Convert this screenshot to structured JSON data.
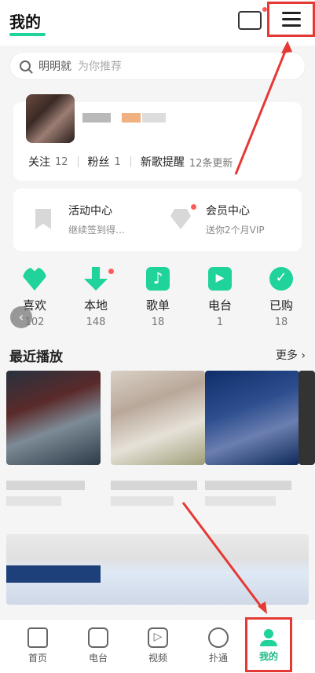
{
  "header": {
    "title": "我的"
  },
  "search": {
    "value": "明明就",
    "hint": "为你推荐"
  },
  "profile": {
    "follow_label": "关注",
    "follow_count": "12",
    "fans_label": "粉丝",
    "fans_count": "1",
    "newsong_label": "新歌提醒",
    "newsong_info": "12条更新"
  },
  "activity": {
    "left": {
      "title": "活动中心",
      "sub": "继续签到得…"
    },
    "right": {
      "title": "会员中心",
      "sub": "送你2个月VIP"
    }
  },
  "quick": [
    {
      "label": "喜欢",
      "count": "102"
    },
    {
      "label": "本地",
      "count": "148"
    },
    {
      "label": "歌单",
      "count": "18"
    },
    {
      "label": "电台",
      "count": "1"
    },
    {
      "label": "已购",
      "count": "18"
    }
  ],
  "recent": {
    "title": "最近播放",
    "more": "更多"
  },
  "tabs": [
    {
      "label": "首页"
    },
    {
      "label": "电台"
    },
    {
      "label": "视频"
    },
    {
      "label": "扑通"
    },
    {
      "label": "我的"
    }
  ],
  "colors": {
    "accent": "#1fd39a",
    "highlight": "#e53935"
  }
}
